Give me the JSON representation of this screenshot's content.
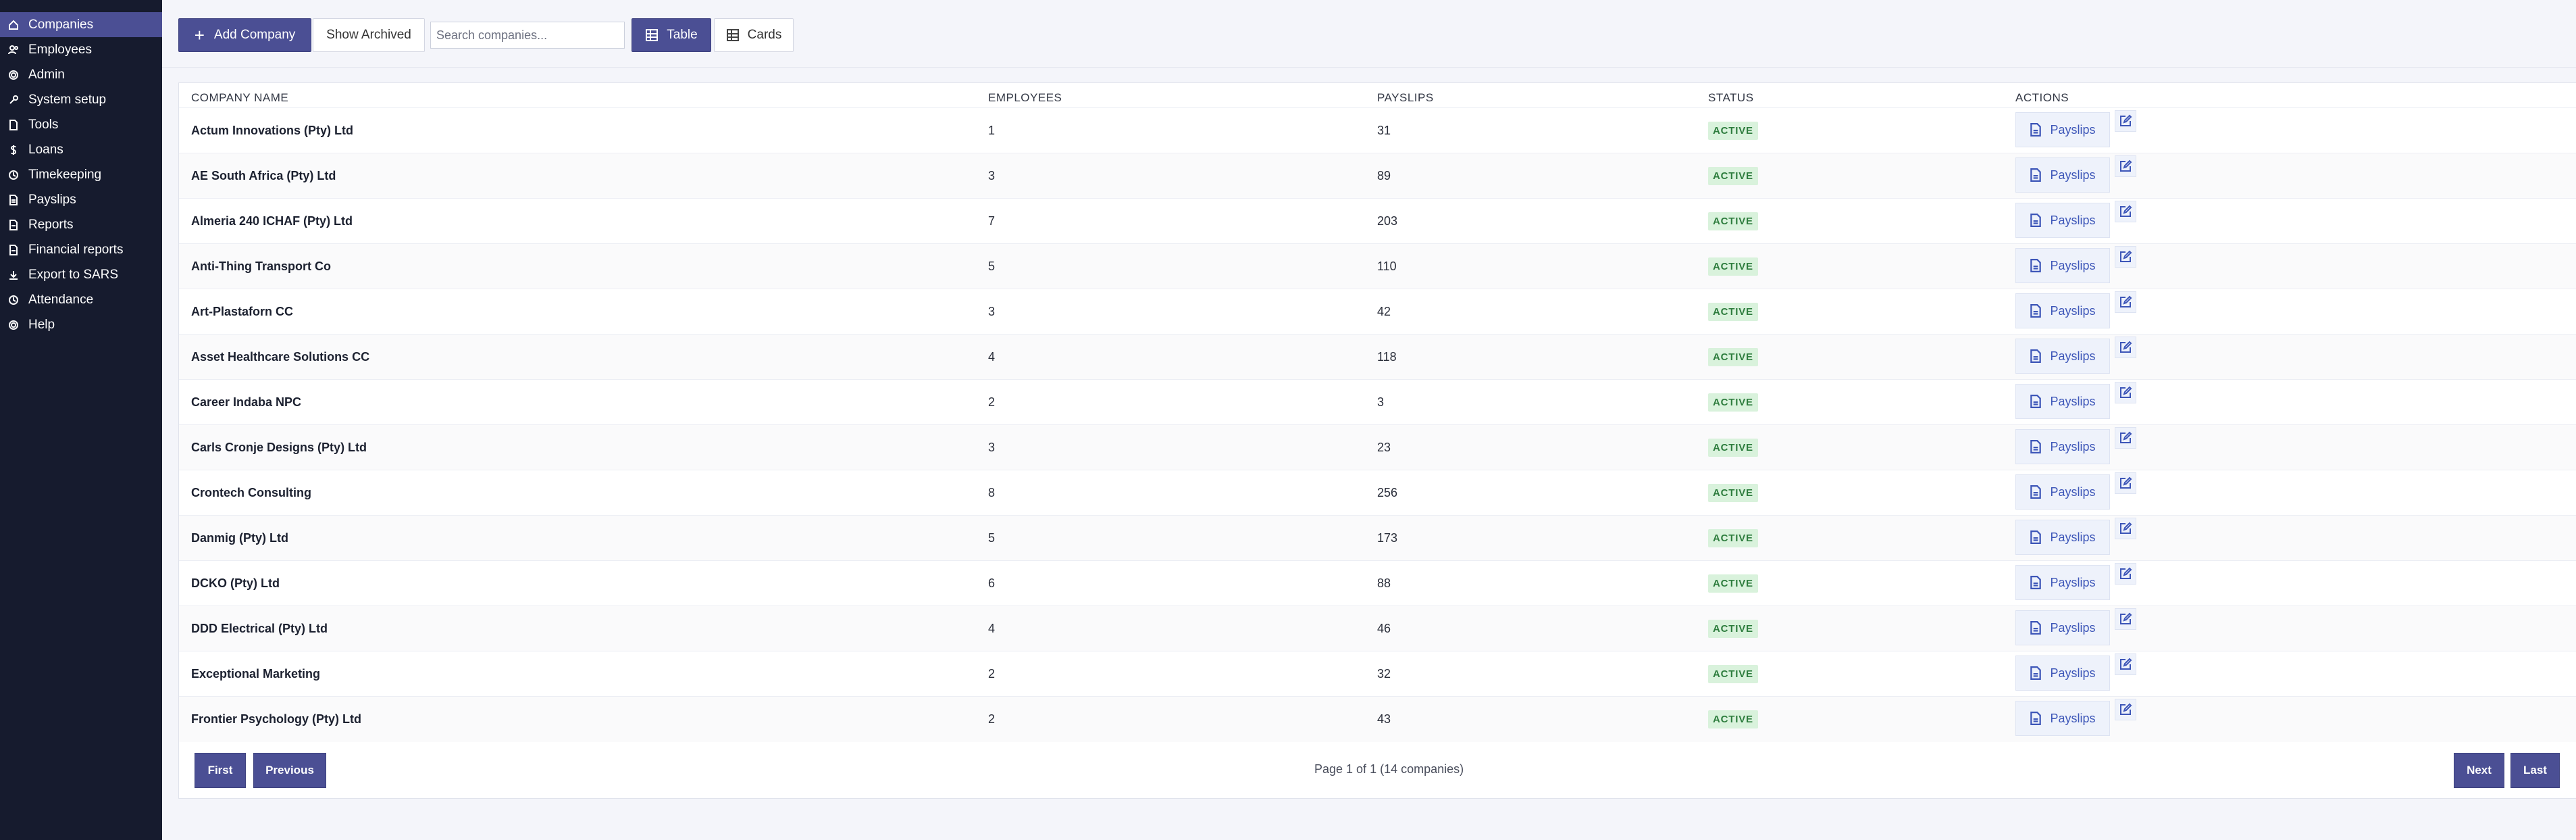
{
  "sidebar": {
    "items": [
      {
        "label": "Companies",
        "icon": "home-icon",
        "active": true
      },
      {
        "label": "Employees",
        "icon": "users-icon"
      },
      {
        "label": "Admin",
        "icon": "gear-icon"
      },
      {
        "label": "System setup",
        "icon": "wrench-icon"
      },
      {
        "label": "Tools",
        "icon": "document-icon"
      },
      {
        "label": "Loans",
        "icon": "dollar-icon"
      },
      {
        "label": "Timekeeping",
        "icon": "clock-icon"
      },
      {
        "label": "Payslips",
        "icon": "payslip-icon"
      },
      {
        "label": "Reports",
        "icon": "report-icon"
      },
      {
        "label": "Financial reports",
        "icon": "report-icon"
      },
      {
        "label": "Export to SARS",
        "icon": "download-icon"
      },
      {
        "label": "Attendance",
        "icon": "clock-icon"
      },
      {
        "label": "Help",
        "icon": "gear-icon"
      }
    ]
  },
  "toolbar": {
    "add_label": "Add Company",
    "archived_label": "Show Archived",
    "search_placeholder": "Search companies...",
    "table_label": "Table",
    "cards_label": "Cards"
  },
  "table": {
    "headers": {
      "name": "COMPANY NAME",
      "employees": "EMPLOYEES",
      "payslips": "PAYSLIPS",
      "status": "STATUS",
      "actions": "ACTIONS"
    },
    "action_label": "Payslips",
    "rows": [
      {
        "name": "Actum Innovations (Pty) Ltd",
        "employees": "1",
        "payslips": "31",
        "status": "ACTIVE"
      },
      {
        "name": "AE South Africa (Pty) Ltd",
        "employees": "3",
        "payslips": "89",
        "status": "ACTIVE"
      },
      {
        "name": "Almeria 240 ICHAF (Pty) Ltd",
        "employees": "7",
        "payslips": "203",
        "status": "ACTIVE"
      },
      {
        "name": "Anti-Thing Transport Co",
        "employees": "5",
        "payslips": "110",
        "status": "ACTIVE"
      },
      {
        "name": "Art-Plastaforn CC",
        "employees": "3",
        "payslips": "42",
        "status": "ACTIVE"
      },
      {
        "name": "Asset Healthcare Solutions CC",
        "employees": "4",
        "payslips": "118",
        "status": "ACTIVE"
      },
      {
        "name": "Career Indaba NPC",
        "employees": "2",
        "payslips": "3",
        "status": "ACTIVE"
      },
      {
        "name": "Carls Cronje Designs (Pty) Ltd",
        "employees": "3",
        "payslips": "23",
        "status": "ACTIVE"
      },
      {
        "name": "Crontech Consulting",
        "employees": "8",
        "payslips": "256",
        "status": "ACTIVE"
      },
      {
        "name": "Danmig (Pty) Ltd",
        "employees": "5",
        "payslips": "173",
        "status": "ACTIVE"
      },
      {
        "name": "DCKO (Pty) Ltd",
        "employees": "6",
        "payslips": "88",
        "status": "ACTIVE"
      },
      {
        "name": "DDD Electrical (Pty) Ltd",
        "employees": "4",
        "payslips": "46",
        "status": "ACTIVE"
      },
      {
        "name": "Exceptional Marketing",
        "employees": "2",
        "payslips": "32",
        "status": "ACTIVE"
      },
      {
        "name": "Frontier Psychology (Pty) Ltd",
        "employees": "2",
        "payslips": "43",
        "status": "ACTIVE"
      }
    ]
  },
  "pagination": {
    "first": "First",
    "previous": "Previous",
    "info": "Page 1 of 1 (14 companies)",
    "next": "Next",
    "last": "Last"
  }
}
